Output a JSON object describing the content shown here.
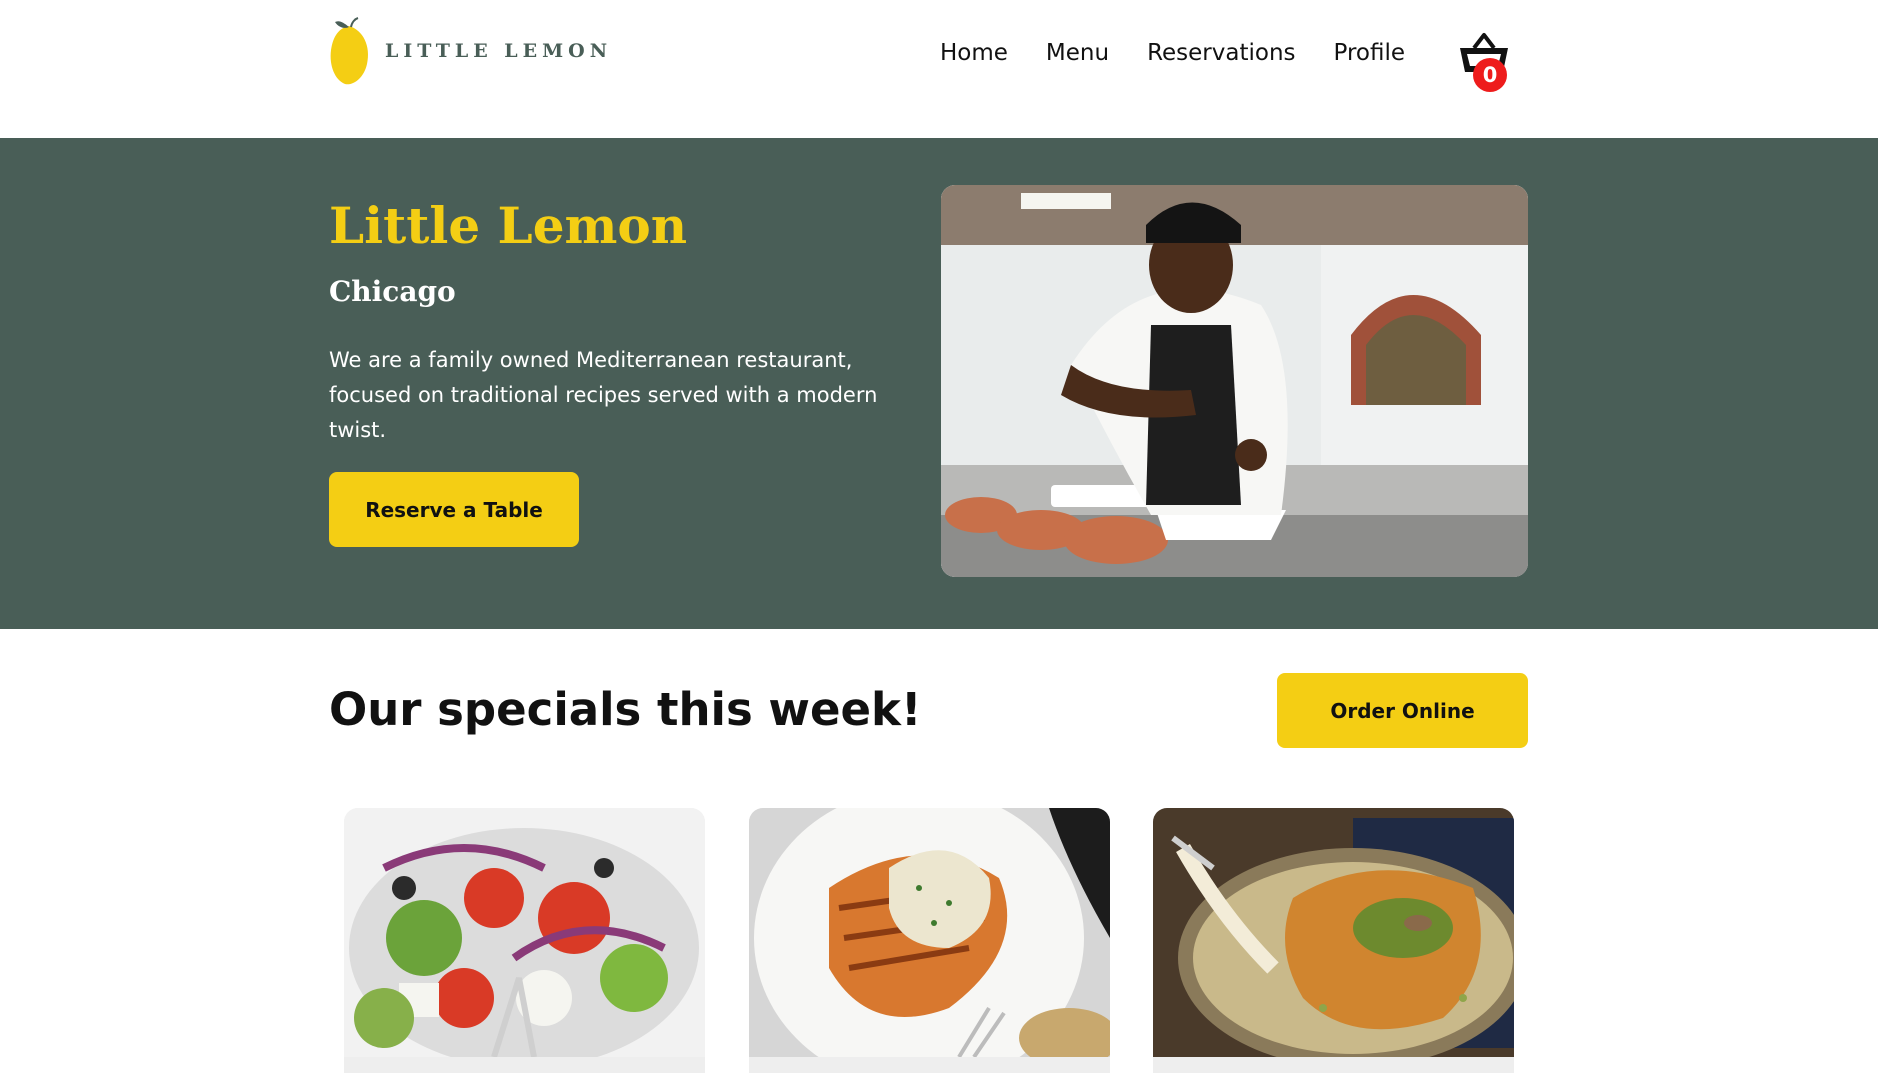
{
  "brand": {
    "name": "LITTLE LEMON",
    "colors": {
      "primary_green": "#495e57",
      "yellow": "#f4ce14",
      "badge_red": "#ee1c1c"
    }
  },
  "nav": {
    "items": [
      {
        "label": "Home"
      },
      {
        "label": "Menu"
      },
      {
        "label": "Reservations"
      },
      {
        "label": "Profile"
      }
    ]
  },
  "cart": {
    "icon": "basket-icon",
    "count": "0"
  },
  "hero": {
    "title": "Little Lemon",
    "subtitle": "Chicago",
    "description": "We are a family owned Mediterranean restaurant, focused on traditional recipes served with a modern twist.",
    "reserve_label": "Reserve a Table",
    "image": "chef-photo"
  },
  "specials": {
    "title": "Our specials this week!",
    "order_label": "Order Online",
    "cards": [
      {
        "image": "greek-salad-photo"
      },
      {
        "image": "grilled-salmon-photo"
      },
      {
        "image": "kunafa-dessert-photo"
      }
    ]
  }
}
